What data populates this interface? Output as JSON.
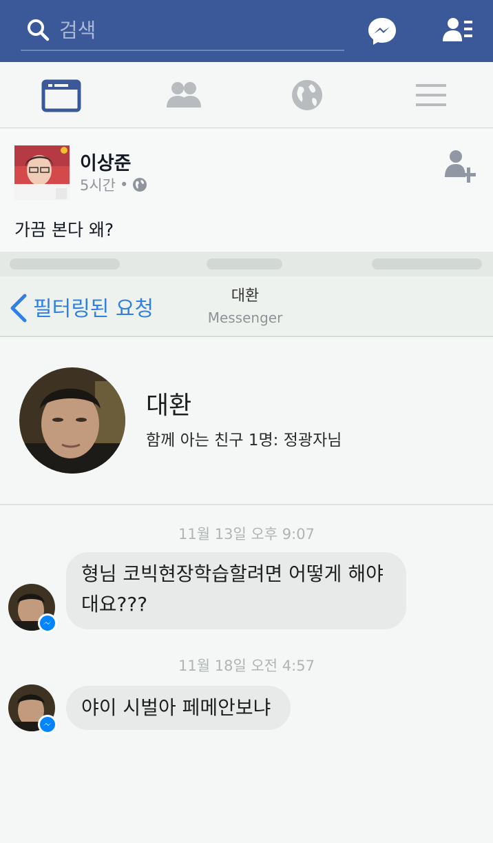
{
  "search": {
    "placeholder": "검색"
  },
  "topbar_icons": [
    "search-icon",
    "messenger-icon",
    "friend-list-icon"
  ],
  "nav_icons": [
    "news-feed-icon",
    "friends-icon",
    "globe-icon",
    "menu-icon"
  ],
  "post": {
    "author": "이상준",
    "time": "5시간",
    "separator": "•",
    "text": "가끔 본다 왜?"
  },
  "screenshot": {
    "back_label": "필터링된 요청",
    "title": "대환",
    "subtitle": "Messenger",
    "profile": {
      "name": "대환",
      "mutual": "함께 아는 친구 1명: 정광자님"
    },
    "messages": [
      {
        "timestamp": "11월 13일 오후 9:07",
        "text_line1": "형님 코빅현장학습할려면 어떻게 해야",
        "text_line2": "대요???"
      },
      {
        "timestamp": "11월 18일 오전 4:57",
        "text_line1": "야이 시벌아 페메안보냐"
      }
    ]
  },
  "colors": {
    "facebook_blue": "#3b5998",
    "messenger_blue": "#0084ff",
    "link_blue": "#2f80e2"
  }
}
